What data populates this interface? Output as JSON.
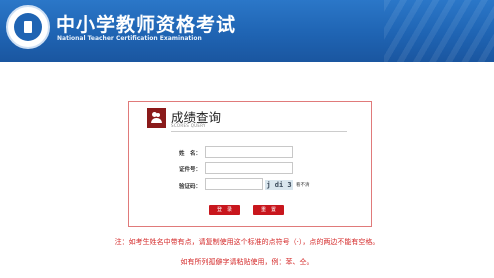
{
  "header": {
    "title_cn": "中小学教师资格考试",
    "title_en": "National Teacher Certification Examination",
    "logo_icon": "exam-emblem-icon"
  },
  "card": {
    "title": "成绩查询",
    "subtitle": "SCORES QUERY",
    "icon": "users-icon"
  },
  "form": {
    "name_label": "姓　名：",
    "id_label": "证件号：",
    "captcha_label": "验证码：",
    "name_value": "",
    "id_value": "",
    "captcha_value": "",
    "captcha_text": "j di 3",
    "refresh_text": "看不清"
  },
  "buttons": {
    "login": "登　录",
    "reset": "重　置"
  },
  "notice": {
    "line1": "注：如考生姓名中带有点，请复制使用这个标准的点符号（·），点的两边不能有空格。",
    "line2": "如有所列孤僻字请粘贴使用，例：苯、仝。"
  },
  "colors": {
    "header_blue": "#1f64b3",
    "accent_red": "#c8161d",
    "notice_red": "#d42a2a"
  }
}
